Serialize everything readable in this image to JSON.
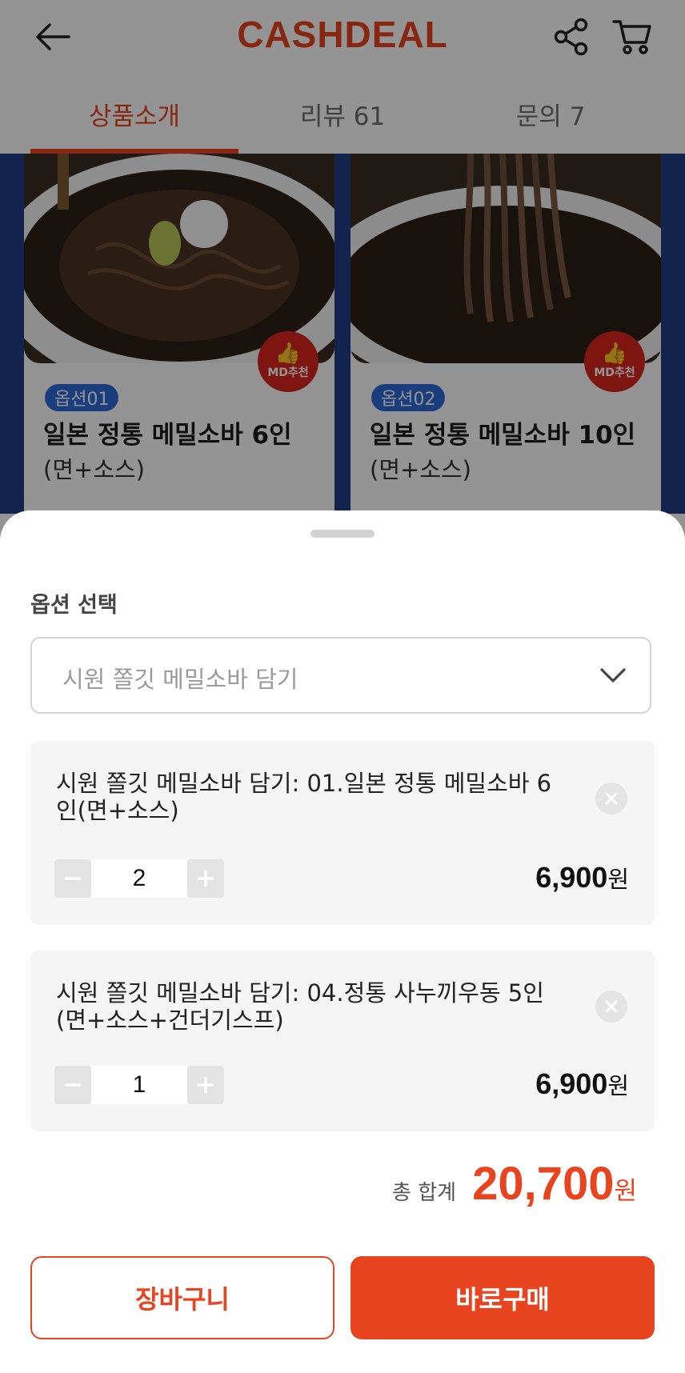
{
  "header": {
    "logo": "CASHDEAL",
    "brand_color": "#e8441f"
  },
  "tabs": [
    {
      "label": "상품소개",
      "active": true
    },
    {
      "label": "리뷰 61",
      "active": false
    },
    {
      "label": "문의 7",
      "active": false
    }
  ],
  "products": [
    {
      "option_tag": "옵션01",
      "title": "일본 정통 메밀소바 6인",
      "subtitle": "(면+소스)",
      "badge": "MD추천"
    },
    {
      "option_tag": "옵션02",
      "title": "일본 정통 메밀소바 10인",
      "subtitle": "(면+소스)",
      "badge": "MD추천"
    }
  ],
  "sheet": {
    "section_label": "옵션 선택",
    "select_value": "시원 쫄깃 메밀소바 담기",
    "items": [
      {
        "name": "시원 쫄깃 메밀소바 담기: 01.일본 정통 메밀소바 6인(면+소스)",
        "quantity": "2",
        "price": "6,900",
        "currency": "원"
      },
      {
        "name": "시원 쫄깃 메밀소바 담기: 04.정통 사누끼우동 5인(면+소스+건더기스프)",
        "quantity": "1",
        "price": "6,900",
        "currency": "원"
      }
    ],
    "total_label": "총 합계",
    "total_value": "20,700",
    "total_currency": "원",
    "cart_button": "장바구니",
    "buy_button": "바로구매"
  },
  "icons": {
    "back": "arrow-left-icon",
    "share": "share-icon",
    "cart": "cart-icon",
    "dropdown": "chevron-down-icon",
    "remove": "close-circle-icon",
    "minus": "minus-icon",
    "plus": "plus-icon"
  }
}
